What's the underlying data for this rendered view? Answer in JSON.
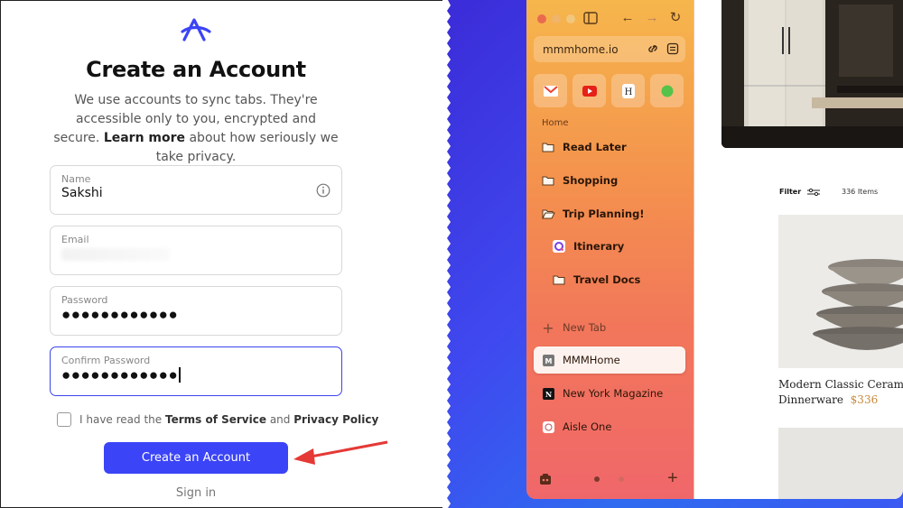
{
  "signup": {
    "title": "Create an Account",
    "subtitle_pre": "We use accounts to sync tabs. They're accessible only to you, encrypted and secure. ",
    "subtitle_link": "Learn more",
    "subtitle_post": " about how seriously we take privacy.",
    "fields": [
      {
        "label": "Name",
        "value": "Sakshi"
      },
      {
        "label": "Email",
        "value": ""
      },
      {
        "label": "Password",
        "value": "●●●●●●●●●●●●"
      },
      {
        "label": "Confirm Password",
        "value": "●●●●●●●●●●●●"
      }
    ],
    "terms_pre": "I have read the ",
    "terms_tos": "Terms of Service",
    "terms_and": " and ",
    "terms_pp": "Privacy Policy",
    "cta_label": "Create an Account",
    "signin_label": "Sign in",
    "accent": "#3b44f6"
  },
  "browser": {
    "url": "mmmhome.io",
    "section_label": "Home",
    "favorites": [
      "gmail-icon",
      "youtube-icon",
      "hinge-icon",
      "spotify-icon"
    ],
    "folders": [
      {
        "label": "Read Later"
      },
      {
        "label": "Shopping"
      },
      {
        "label": "Trip Planning!"
      },
      {
        "label": "Itinerary"
      },
      {
        "label": "Travel Docs"
      }
    ],
    "new_tab_label": "New Tab",
    "tabs": [
      {
        "label": "MMMHome",
        "active": true
      },
      {
        "label": "New York Magazine"
      },
      {
        "label": "Aisle One"
      }
    ]
  },
  "page": {
    "filter_label": "Filter",
    "item_count": "336 Items",
    "product_name_1": "Modern Classic Ceramic",
    "product_name_2": "Dinnerware",
    "product_price": "$336"
  }
}
